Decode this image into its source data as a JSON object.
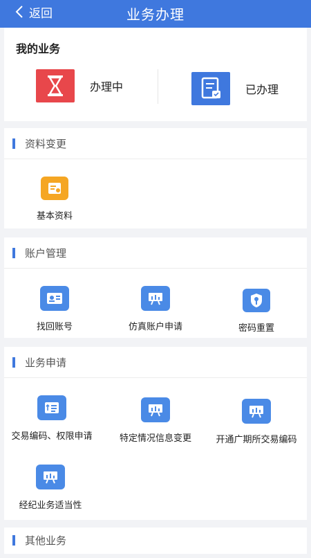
{
  "header": {
    "back_label": "返回",
    "title": "业务办理"
  },
  "my_business": {
    "title": "我的业务",
    "items": [
      {
        "label": "办理中",
        "icon": "hourglass-icon",
        "color": "#e8474b"
      },
      {
        "label": "已办理",
        "icon": "document-check-icon",
        "color": "#3f78de"
      }
    ]
  },
  "sections": [
    {
      "title": "资料变更",
      "items": [
        {
          "label": "基本资料",
          "icon": "profile-card-icon",
          "color": "#f5a623"
        }
      ]
    },
    {
      "title": "账户管理",
      "items": [
        {
          "label": "找回账号",
          "icon": "id-card-icon"
        },
        {
          "label": "仿真账户申请",
          "icon": "presentation-icon"
        },
        {
          "label": "密码重置",
          "icon": "shield-key-icon"
        }
      ]
    },
    {
      "title": "业务申请",
      "items": [
        {
          "label": "交易编码、权限申请",
          "icon": "list-icon"
        },
        {
          "label": "特定情况信息变更",
          "icon": "presentation-icon"
        },
        {
          "label": "开通广期所交易编码",
          "icon": "presentation-icon"
        },
        {
          "label": "经纪业务适当性",
          "icon": "presentation-icon"
        }
      ]
    },
    {
      "title": "其他业务",
      "items": []
    }
  ],
  "accent_color": "#3f78de"
}
